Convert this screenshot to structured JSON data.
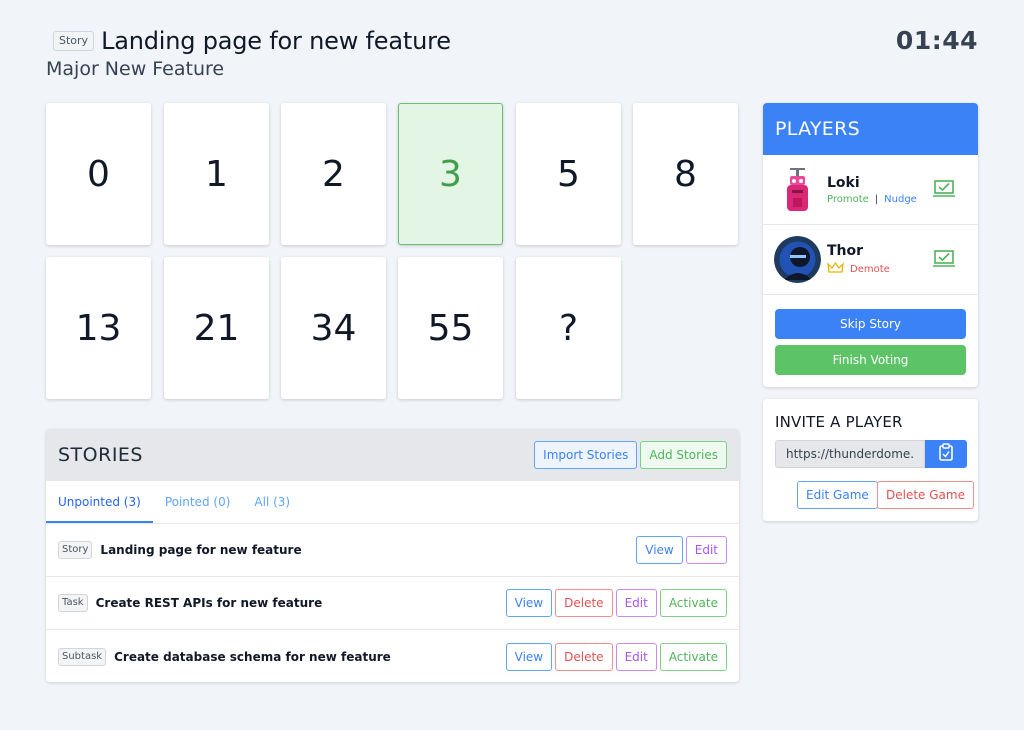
{
  "header": {
    "story_type": "Story",
    "story_title": "Landing page for new feature",
    "subtitle": "Major New Feature",
    "timer": "01:44"
  },
  "cards": [
    {
      "value": "0"
    },
    {
      "value": "1"
    },
    {
      "value": "2"
    },
    {
      "value": "3",
      "selected": true
    },
    {
      "value": "5"
    },
    {
      "value": "8"
    },
    {
      "value": "13"
    },
    {
      "value": "21"
    },
    {
      "value": "34"
    },
    {
      "value": "55"
    },
    {
      "value": "?"
    }
  ],
  "stories": {
    "title": "STORIES",
    "import_label": "Import Stories",
    "add_label": "Add Stories",
    "tabs": [
      {
        "label": "Unpointed (3)",
        "active": true
      },
      {
        "label": "Pointed (0)"
      },
      {
        "label": "All (3)"
      }
    ],
    "rows": [
      {
        "type": "Story",
        "title": "Landing page for new feature",
        "view": "View",
        "edit": "Edit"
      },
      {
        "type": "Task",
        "title": "Create REST APIs for new feature",
        "view": "View",
        "delete": "Delete",
        "edit": "Edit",
        "activate": "Activate"
      },
      {
        "type": "Subtask",
        "title": "Create database schema for new feature",
        "view": "View",
        "delete": "Delete",
        "edit": "Edit",
        "activate": "Activate"
      }
    ]
  },
  "players": {
    "title": "PLAYERS",
    "list": [
      {
        "name": "Loki",
        "promote": "Promote",
        "separator": "|",
        "nudge": "Nudge",
        "voted": true
      },
      {
        "name": "Thor",
        "demote": "Demote",
        "leader": true,
        "voted": true
      }
    ],
    "skip_label": "Skip Story",
    "finish_label": "Finish Voting"
  },
  "invite": {
    "title": "INVITE A PLAYER",
    "link": "https://thunderdome.dev",
    "edit_game_label": "Edit Game",
    "delete_game_label": "Delete Game"
  },
  "colors": {
    "primary": "#3b82f6",
    "success": "#5cc366",
    "danger": "#e05252",
    "purple": "#a855f7",
    "selected_card_bg": "#e3f6e6"
  }
}
